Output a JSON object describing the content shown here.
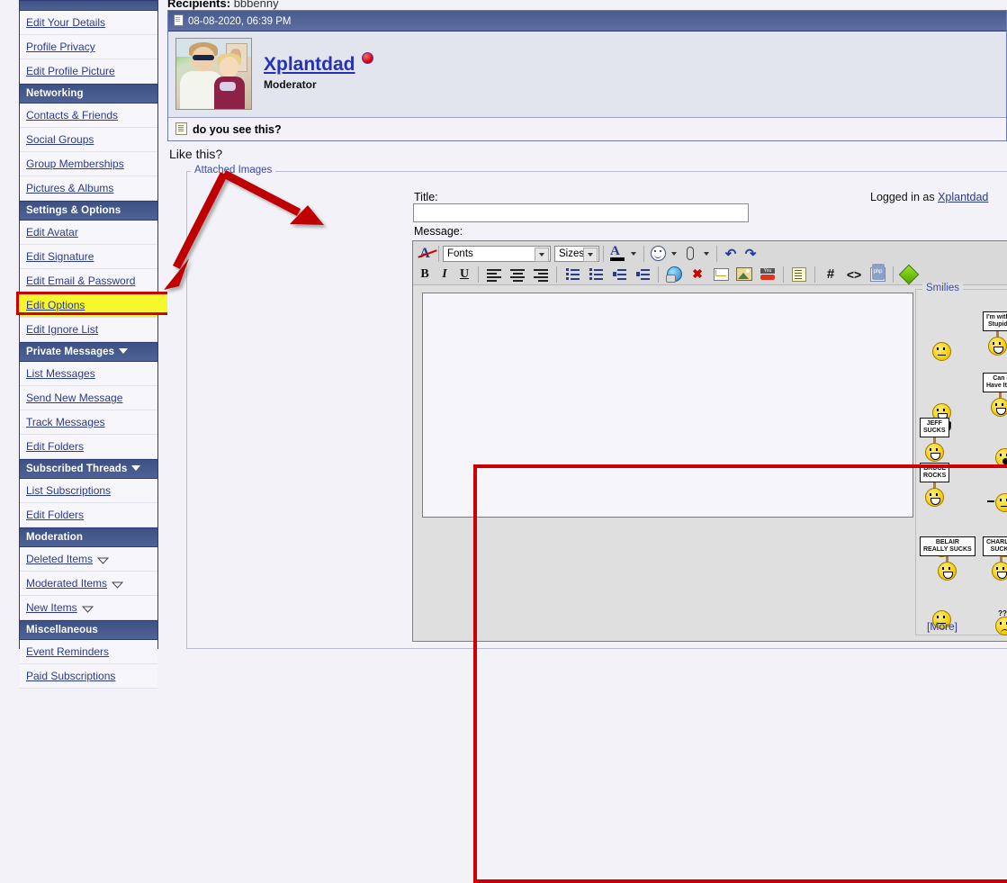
{
  "sidebar": {
    "sections": [
      {
        "header": null,
        "items": [
          {
            "label": "Edit Your Details",
            "caret": false
          },
          {
            "label": "Profile Privacy",
            "caret": false
          },
          {
            "label": "Edit Profile Picture",
            "caret": false
          }
        ]
      },
      {
        "header": "Networking",
        "header_caret": false,
        "items": [
          {
            "label": "Contacts & Friends",
            "caret": false
          },
          {
            "label": "Social Groups",
            "caret": false
          },
          {
            "label": "Group Memberships",
            "caret": false
          },
          {
            "label": "Pictures & Albums",
            "caret": false
          }
        ]
      },
      {
        "header": "Settings & Options",
        "header_caret": false,
        "items": [
          {
            "label": "Edit Avatar",
            "caret": false
          },
          {
            "label": "Edit Signature",
            "caret": false
          },
          {
            "label": "Edit Email & Password",
            "caret": false
          },
          {
            "label": "Edit Options",
            "caret": false,
            "highlighted": true
          },
          {
            "label": "Edit Ignore List",
            "caret": false
          }
        ]
      },
      {
        "header": "Private Messages",
        "header_caret": true,
        "items": [
          {
            "label": "List Messages",
            "caret": false
          },
          {
            "label": "Send New Message",
            "caret": false
          },
          {
            "label": "Track Messages",
            "caret": false
          },
          {
            "label": "Edit Folders",
            "caret": false
          }
        ]
      },
      {
        "header": "Subscribed Threads",
        "header_caret": true,
        "items": [
          {
            "label": "List Subscriptions",
            "caret": false
          },
          {
            "label": "Edit Folders",
            "caret": false
          }
        ]
      },
      {
        "header": "Moderation",
        "header_caret": false,
        "items": [
          {
            "label": "Deleted Items",
            "caret": true
          },
          {
            "label": "Moderated Items",
            "caret": true
          },
          {
            "label": "New Items",
            "caret": true
          }
        ]
      },
      {
        "header": "Miscellaneous",
        "header_caret": false,
        "items": [
          {
            "label": "Event Reminders",
            "caret": false
          },
          {
            "label": "Paid Subscriptions",
            "caret": false
          }
        ]
      }
    ]
  },
  "main": {
    "recipients_label": "Recipients",
    "recipients_value": "bbbenny",
    "post": {
      "date": "08-08-2020, 06:39 PM",
      "username": "Xplantdad",
      "usertitle": "Moderator",
      "subject": "do you see this?"
    },
    "like_this": "Like this?",
    "attached_images_legend": "Attached Images",
    "title_label": "Title:",
    "title_value": "",
    "title_placeholder": "",
    "logged_in_prefix": "Logged in as",
    "logged_in_user": "Xplantdad",
    "message_label": "Message:",
    "message_value": ""
  },
  "editor": {
    "fonts_select": "Fonts",
    "sizes_select": "Sizes",
    "toolbar_row1": [
      {
        "name": "remove-formatting-icon",
        "title": "Remove Text Formatting"
      },
      {
        "name": "fonts-dropdown",
        "title": "Fonts"
      },
      {
        "name": "sizes-dropdown",
        "title": "Sizes"
      },
      {
        "name": "font-color-icon",
        "title": "Font Color"
      },
      {
        "name": "smilie-icon",
        "title": "Insert Smilie"
      },
      {
        "name": "attachment-icon",
        "title": "Attachments"
      },
      {
        "name": "undo-icon",
        "title": "Undo"
      },
      {
        "name": "redo-icon",
        "title": "Redo"
      }
    ],
    "toolbar_row2": [
      {
        "name": "bold-icon",
        "label": "B"
      },
      {
        "name": "italic-icon",
        "label": "I"
      },
      {
        "name": "underline-icon",
        "label": "U"
      },
      {
        "name": "align-left-icon",
        "label": ""
      },
      {
        "name": "align-center-icon",
        "label": ""
      },
      {
        "name": "align-right-icon",
        "label": ""
      },
      {
        "name": "ordered-list-icon",
        "label": ""
      },
      {
        "name": "bullet-list-icon",
        "label": ""
      },
      {
        "name": "outdent-icon",
        "label": ""
      },
      {
        "name": "indent-icon",
        "label": ""
      },
      {
        "name": "insert-link-icon",
        "label": ""
      },
      {
        "name": "remove-link-icon",
        "label": ""
      },
      {
        "name": "insert-email-icon",
        "label": ""
      },
      {
        "name": "insert-image-icon",
        "label": ""
      },
      {
        "name": "insert-video-icon",
        "label": ""
      },
      {
        "name": "wrap-quote-icon",
        "label": ""
      },
      {
        "name": "insert-hash-icon",
        "label": "#"
      },
      {
        "name": "insert-code-icon",
        "label": "<>"
      },
      {
        "name": "insert-php-icon",
        "label": ""
      },
      {
        "name": "insert-gem-icon",
        "label": ""
      }
    ],
    "resize_handle": "resize-icon",
    "toggle_editor_icon": "toggle-wysiwyg-icon",
    "smilies_legend": "Smilies",
    "smilies_more": "[More]",
    "smilies": [
      {
        "row": 0,
        "col": 0,
        "type": "face",
        "mouth": "flat",
        "name": "smilie-confused"
      },
      {
        "row": 0,
        "col": 1,
        "type": "sign",
        "text": "I'm with\nStupid",
        "name": "smilie-im-with-stupid"
      },
      {
        "row": 0,
        "col": 2,
        "type": "face",
        "mouth": "grin",
        "shades": true,
        "name": "smilie-cool"
      },
      {
        "row": 1,
        "col": 0,
        "type": "face-holder",
        "name": "smilie-bow"
      },
      {
        "row": 1,
        "col": 1,
        "type": "sign",
        "text": "Can I\nHave It??",
        "name": "smilie-can-i-have-it"
      },
      {
        "row": 1,
        "col": 2,
        "type": "face",
        "mouth": "grin",
        "name": "smilie-big-grin"
      },
      {
        "row": 2,
        "col": 0,
        "type": "sign",
        "text": "JEFF\nSUCKS",
        "name": "smilie-jeff-sucks"
      },
      {
        "row": 2,
        "col": 1,
        "type": "face",
        "mouth": "o",
        "name": "smilie-surprised"
      },
      {
        "row": 2,
        "col": 2,
        "type": "blob",
        "name": "smilie-blob"
      },
      {
        "row": 3,
        "col": 0,
        "type": "sign",
        "text": "BRUCE\nROCKS",
        "name": "smilie-bruce-rocks"
      },
      {
        "row": 3,
        "col": 1,
        "type": "face",
        "mouth": "flat",
        "wings": true,
        "name": "smilie-flying"
      },
      {
        "row": 3,
        "col": 2,
        "type": "face",
        "mouth": "flat",
        "wave": true,
        "name": "smilie-wave"
      },
      {
        "row": 4,
        "col": 0,
        "type": "face",
        "mouth": "o",
        "name": "smilie-oh"
      },
      {
        "row": 4,
        "col": 1,
        "type": "face",
        "mouth": "flat",
        "phone": true,
        "name": "smilie-phone"
      },
      {
        "row": 4,
        "col": 2,
        "type": "face",
        "mouth": "sad",
        "name": "smilie-frown"
      },
      {
        "row": 5,
        "col": 0,
        "type": "sign",
        "text": "BELAIR\nREALLY SUCKS",
        "name": "smilie-belair-really-sucks"
      },
      {
        "row": 5,
        "col": 1,
        "type": "sign",
        "text": "CHARLEY\nSUCKS",
        "name": "smilie-charley-sucks"
      },
      {
        "row": 5,
        "col": 2,
        "type": "face",
        "mouth": "grin",
        "name": "smilie-grin2"
      },
      {
        "row": 6,
        "col": 0,
        "type": "face",
        "mouth": "flat",
        "name": "smilie-smirk"
      },
      {
        "row": 6,
        "col": 1,
        "type": "face",
        "mouth": "sad",
        "qmarks": "???",
        "name": "smilie-confused-questions"
      }
    ]
  },
  "colors": {
    "accent": "#2b3a8c",
    "header_bar": "#4f6296",
    "highlight_yellow": "#f2f22a",
    "annotation_red": "#cc0000",
    "link": "#2532b8"
  }
}
